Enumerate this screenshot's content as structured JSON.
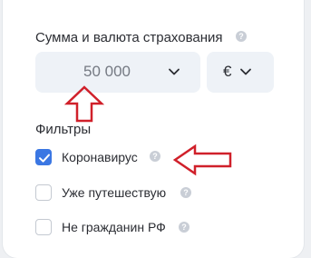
{
  "insurance": {
    "title": "Сумма и валюта страхования",
    "amount_value": "50 000",
    "currency_value": "€"
  },
  "filters": {
    "title": "Фильтры",
    "items": [
      {
        "label": "Коронавирус",
        "checked": true
      },
      {
        "label": "Уже путешествую",
        "checked": false
      },
      {
        "label": "Не гражданин РФ",
        "checked": false
      }
    ]
  },
  "icons": {
    "help": "question-circle-icon",
    "chevron": "chevron-down-icon",
    "check": "checkmark-icon"
  },
  "colors": {
    "accent": "#3b77e3",
    "annotation": "#d0202a",
    "field_bg": "#eef2f7"
  }
}
